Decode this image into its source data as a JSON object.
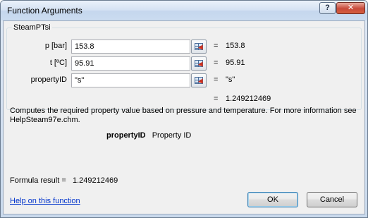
{
  "window": {
    "title": "Function Arguments",
    "help_button": "?",
    "close_button": "✕"
  },
  "group": {
    "name": "SteamPTsi"
  },
  "arguments": [
    {
      "label": "p [bar]",
      "value": "153.8",
      "eq": "=",
      "result": "153.8"
    },
    {
      "label": "t [ºC]",
      "value": "95.91",
      "eq": "=",
      "result": "95.91"
    },
    {
      "label": "propertyID",
      "value": "\"s\"",
      "eq": "=",
      "result": "\"s\""
    }
  ],
  "overall": {
    "eq": "=",
    "result": "1.249212469"
  },
  "description": "Computes the required property value based on pressure and temperature. For more information see HelpSteam97e.chm.",
  "argument_help": {
    "name": "propertyID",
    "text": "Property ID"
  },
  "formula_result": {
    "label": "Formula result =",
    "value": "1.249212469"
  },
  "footer": {
    "help_link": "Help on this function",
    "ok_label": "OK",
    "cancel_label": "Cancel"
  },
  "icons": {
    "collapse_dialog": "collapse-dialog-icon"
  },
  "colors": {
    "link": "#0033cc",
    "close_button": "#c8493a"
  }
}
